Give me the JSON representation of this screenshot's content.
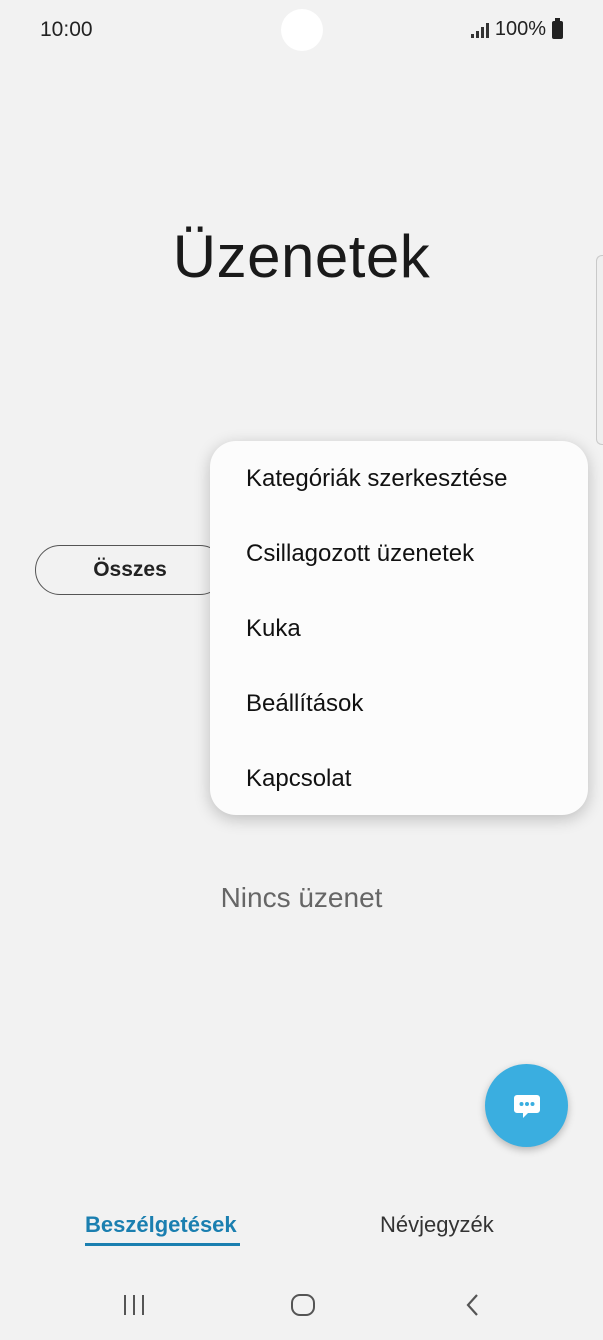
{
  "status_bar": {
    "time": "10:00",
    "battery_text": "100%"
  },
  "page": {
    "title": "Üzenetek",
    "filter_chip": "Összes",
    "empty_message": "Nincs üzenet"
  },
  "menu": {
    "items": [
      {
        "label": "Kategóriák szerkesztése"
      },
      {
        "label": "Csillagozott üzenetek"
      },
      {
        "label": "Kuka"
      },
      {
        "label": "Beállítások"
      },
      {
        "label": "Kapcsolat"
      }
    ]
  },
  "fab": {
    "icon": "new-message-icon",
    "color": "#3aaee0"
  },
  "bottom_tabs": [
    {
      "label": "Beszélgetések",
      "active": true
    },
    {
      "label": "Névjegyzék",
      "active": false
    }
  ],
  "navbar": {
    "icons": [
      "recent-apps-icon",
      "home-icon",
      "back-icon"
    ]
  },
  "colors": {
    "background": "#f2f2f2",
    "accent": "#1b7fb0"
  }
}
